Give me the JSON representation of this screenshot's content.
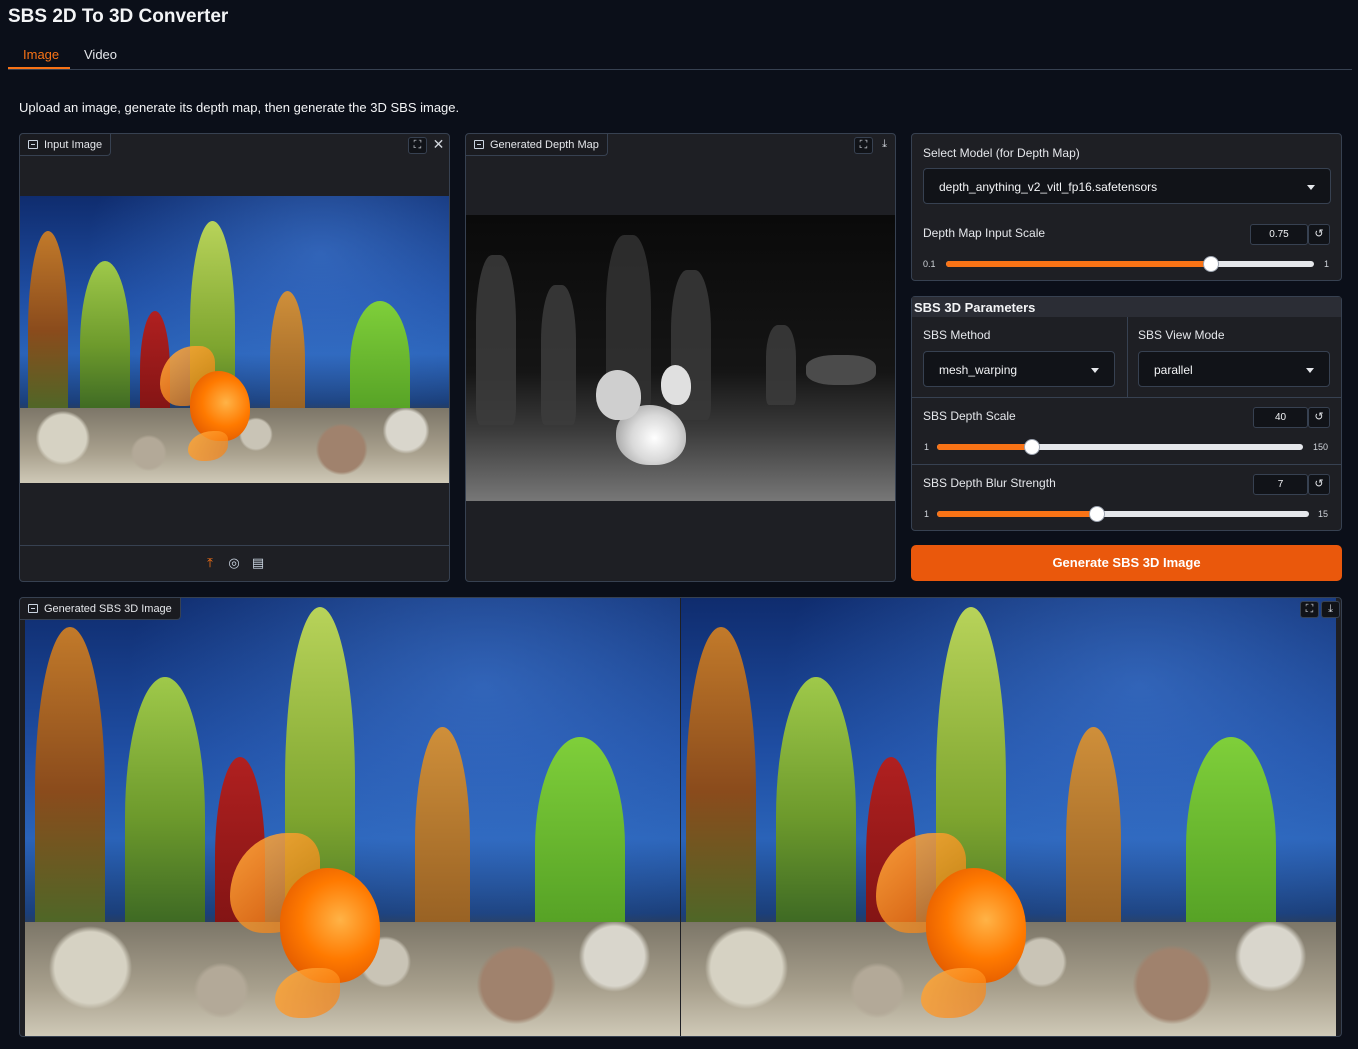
{
  "app": {
    "title": "SBS 2D To 3D Converter"
  },
  "tabs": [
    {
      "label": "Image",
      "active": true
    },
    {
      "label": "Video",
      "active": false
    }
  ],
  "description": "Upload an image, generate its depth map, then generate the 3D SBS image.",
  "input_image": {
    "label": "Input Image"
  },
  "depth_map": {
    "label": "Generated Depth Map"
  },
  "model": {
    "label": "Select Model (for Depth Map)",
    "selected": "depth_anything_v2_vitl_fp16.safetensors"
  },
  "depth_input_scale": {
    "label": "Depth Map Input Scale",
    "value": "0.75",
    "min": "0.1",
    "max": "1",
    "fraction": 0.72
  },
  "sbs_params": {
    "header": "SBS 3D Parameters"
  },
  "sbs_method": {
    "label": "SBS Method",
    "selected": "mesh_warping"
  },
  "sbs_view_mode": {
    "label": "SBS View Mode",
    "selected": "parallel"
  },
  "sbs_depth_scale": {
    "label": "SBS Depth Scale",
    "value": "40",
    "min": "1",
    "max": "150",
    "fraction": 0.26
  },
  "sbs_blur": {
    "label": "SBS Depth Blur Strength",
    "value": "7",
    "min": "1",
    "max": "15",
    "fraction": 0.43
  },
  "generate_button": {
    "label": "Generate SBS 3D Image"
  },
  "output": {
    "label": "Generated SBS 3D Image"
  },
  "colors": {
    "accent": "#f97316",
    "button": "#ea580c",
    "background": "#0b0f19"
  }
}
